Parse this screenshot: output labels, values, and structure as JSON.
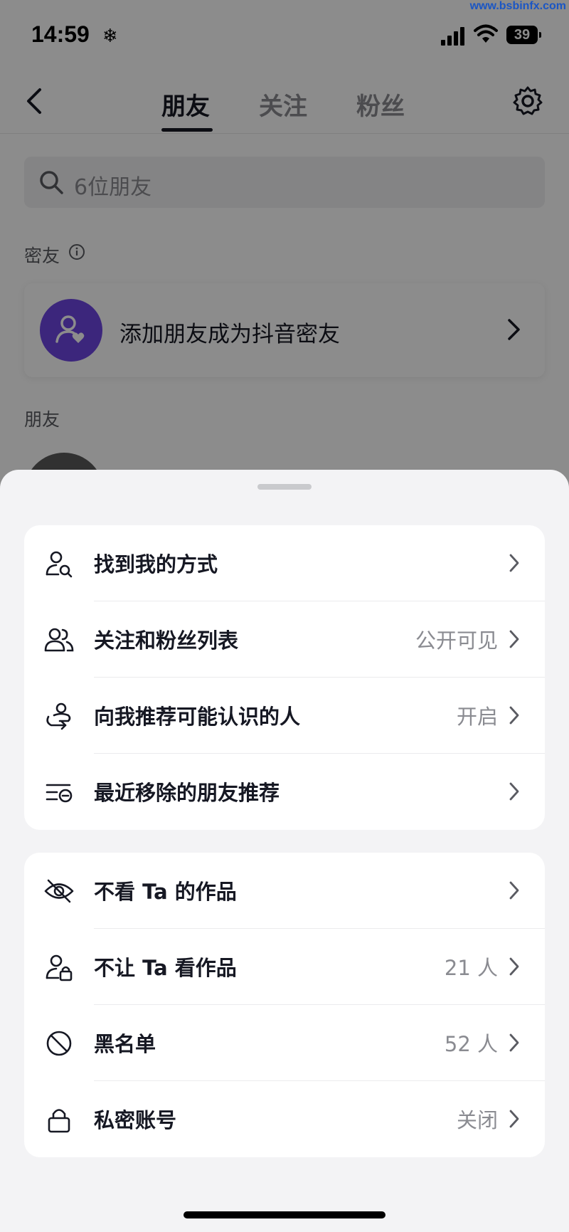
{
  "watermark": "www.bsbinfx.com",
  "status_bar": {
    "time": "14:59",
    "battery": "39"
  },
  "nav": {
    "tabs": [
      {
        "label": "朋友",
        "active": true
      },
      {
        "label": "关注",
        "active": false
      },
      {
        "label": "粉丝",
        "active": false
      }
    ]
  },
  "search": {
    "placeholder": "6位朋友"
  },
  "sections": {
    "close_friends_title": "密友",
    "close_friends_card_text": "添加朋友成为抖音密友",
    "friends_title": "朋友"
  },
  "colors": {
    "accent_purple": "#6e45e2",
    "sheet_bg": "#f3f3f5",
    "value_gray": "#8a8b91"
  },
  "sheet": {
    "group1": [
      {
        "icon": "user-search-icon",
        "label": "找到我的方式",
        "value": ""
      },
      {
        "icon": "users-icon",
        "label": "关注和粉丝列表",
        "value": "公开可见"
      },
      {
        "icon": "recommend-people-icon",
        "label": "向我推荐可能认识的人",
        "value": "开启"
      },
      {
        "icon": "removed-list-icon",
        "label": "最近移除的朋友推荐",
        "value": ""
      }
    ],
    "group2": [
      {
        "icon": "eye-off-icon",
        "label": "不看 Ta 的作品",
        "value": ""
      },
      {
        "icon": "user-lock-icon",
        "label": "不让 Ta 看作品",
        "value": "21 人"
      },
      {
        "icon": "block-icon",
        "label": "黑名单",
        "value": "52 人"
      },
      {
        "icon": "lock-icon",
        "label": "私密账号",
        "value": "关闭"
      }
    ]
  }
}
